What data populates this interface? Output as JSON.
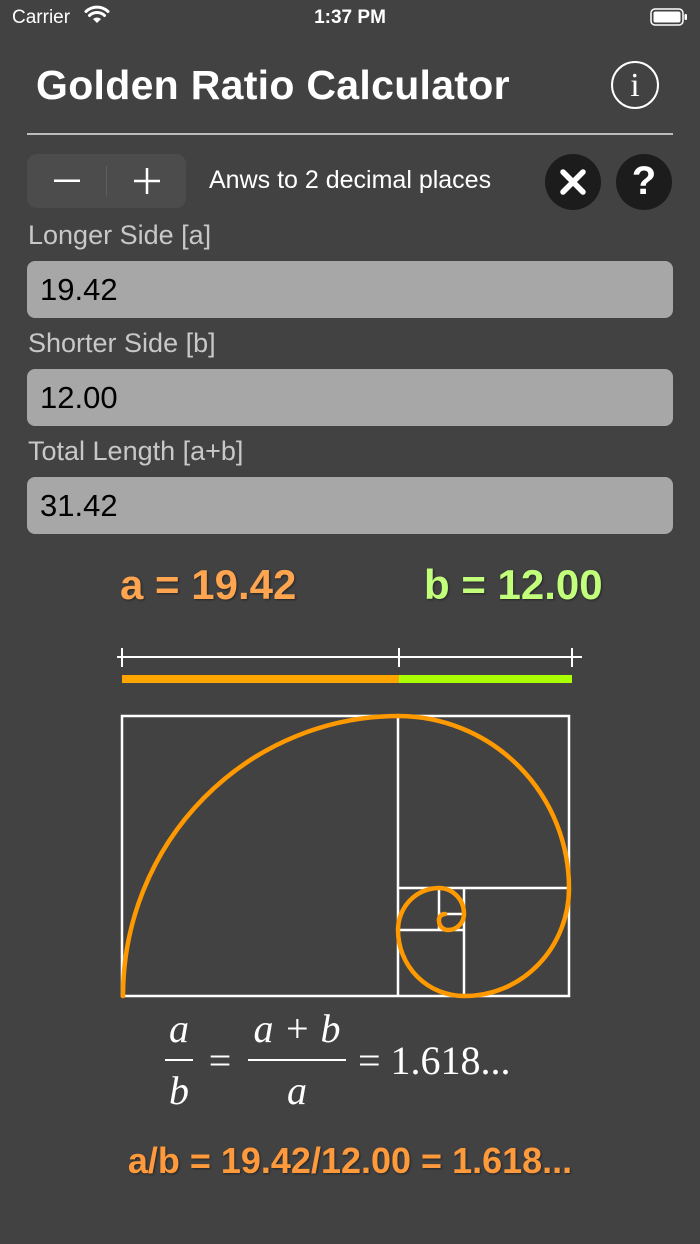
{
  "status_bar": {
    "carrier": "Carrier",
    "time": "1:37 PM"
  },
  "header": {
    "title": "Golden Ratio Calculator",
    "info_icon": "info-icon"
  },
  "controls": {
    "precision_label": "Anws to 2 decimal places",
    "minus_icon": "minus-icon",
    "plus_icon": "plus-icon",
    "clear_icon": "close-icon",
    "help_label": "?"
  },
  "fields": {
    "longer": {
      "label": "Longer Side [a]",
      "value": "19.42"
    },
    "shorter": {
      "label": "Shorter Side [b]",
      "value": "12.00"
    },
    "total": {
      "label": "Total Length [a+b]",
      "value": "31.42"
    }
  },
  "results": {
    "a": "a = 19.42",
    "b": "b = 12.00",
    "ratio": "a/b = 19.42/12.00 = 1.618..."
  },
  "formula": {
    "a": "a",
    "b": "b",
    "eq": "=",
    "a_plus_b": "a + b",
    "value": "= 1.618..."
  },
  "colors": {
    "background": "#424242",
    "accent_a": "#ffa500",
    "accent_b": "#aaff00",
    "result_a": "#ffa54f",
    "result_b": "#c2ff7a"
  }
}
